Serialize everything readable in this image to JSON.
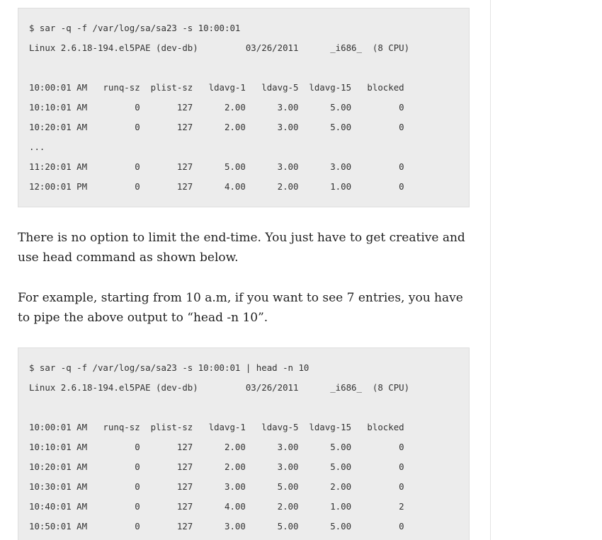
{
  "code_block_1": {
    "lines": [
      "$ sar -q -f /var/log/sa/sa23 -s 10:00:01",
      "Linux 2.6.18-194.el5PAE (dev-db)         03/26/2011      _i686_  (8 CPU)",
      "",
      "10:00:01 AM   runq-sz  plist-sz   ldavg-1   ldavg-5  ldavg-15   blocked",
      "10:10:01 AM         0       127      2.00      3.00      5.00         0",
      "10:20:01 AM         0       127      2.00      3.00      5.00         0",
      "...",
      "11:20:01 AM         0       127      5.00      3.00      3.00         0",
      "12:00:01 PM         0       127      4.00      2.00      1.00         0"
    ]
  },
  "paragraph_1": "There is no option to limit the end-time. You just have to get creative and use head command as shown below.",
  "paragraph_2": "For example, starting from 10 a.m, if you want to see 7 entries, you have to pipe the above output to “head -n 10”.",
  "code_block_2": {
    "lines": [
      "$ sar -q -f /var/log/sa/sa23 -s 10:00:01 | head -n 10",
      "Linux 2.6.18-194.el5PAE (dev-db)         03/26/2011      _i686_  (8 CPU)",
      "",
      "10:00:01 AM   runq-sz  plist-sz   ldavg-1   ldavg-5  ldavg-15   blocked",
      "10:10:01 AM         0       127      2.00      3.00      5.00         0",
      "10:20:01 AM         0       127      2.00      3.00      5.00         0",
      "10:30:01 AM         0       127      3.00      5.00      2.00         0",
      "10:40:01 AM         0       127      4.00      2.00      1.00         2",
      "10:50:01 AM         0       127      3.00      5.00      5.00         0"
    ]
  }
}
